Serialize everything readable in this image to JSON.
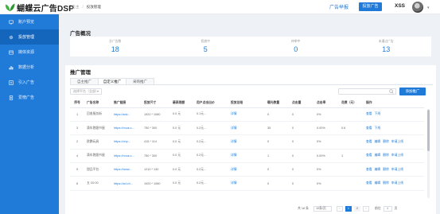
{
  "brand": {
    "name": "蝴蝶云广告DSP",
    "accent": "#1f7ad8",
    "sidebar_active": "#1466bd"
  },
  "breadcrumb": [
    "广告主",
    "投放管理"
  ],
  "header": {
    "link_label": "广告举报",
    "button_label": "投放广告",
    "username": "XSS"
  },
  "sidebar": {
    "items": [
      {
        "label": "账户预览",
        "icon": "monitor-icon",
        "active": false
      },
      {
        "label": "投放管理",
        "icon": "gear-icon",
        "active": true
      },
      {
        "label": "媒体资源",
        "icon": "media-icon",
        "active": false
      },
      {
        "label": "数据分析",
        "icon": "chart-icon",
        "active": false
      },
      {
        "label": "引入广告",
        "icon": "import-icon",
        "active": false
      },
      {
        "label": "爱榜广告",
        "icon": "doc-icon",
        "active": false
      }
    ]
  },
  "overview": {
    "title": "广告概况",
    "stats": [
      {
        "label": "总广告数",
        "value": "18"
      },
      {
        "label": "投放中",
        "value": "5"
      },
      {
        "label": "待审中",
        "value": "0"
      },
      {
        "label": "未通过广告",
        "value": "13"
      }
    ]
  },
  "promo": {
    "title": "推广管理",
    "tabs": [
      {
        "label": "自主推广",
        "active": false
      },
      {
        "label": "自定义推广",
        "active": true
      },
      {
        "label": "采购推广",
        "active": false
      }
    ],
    "filter_label": "选择平台（全部）",
    "search_placeholder": "",
    "add_button": "添加推广",
    "columns": [
      "序号",
      "广告名称",
      "推广链接",
      "投放尺寸",
      "最高限额",
      "用户点击出价",
      "投放总结",
      "曝光数量",
      "点击量",
      "点击率",
      "花费（元）",
      "操作"
    ],
    "rows": [
      {
        "no": "1",
        "name": "回收服务街",
        "url": "https://adv...",
        "size": "1920 * 1080",
        "limit": "0.0 元",
        "bid": "0.1元...",
        "summary": "详情",
        "views": "0",
        "clicks": "0",
        "ctr": "0%",
        "cost": "",
        "ops": [
          "查看",
          "下线"
        ]
      },
      {
        "no": "3",
        "name": "滴车跑跟书屋",
        "url": "https://nous.c...",
        "size": "750 * 300",
        "limit": "0.0 元",
        "bid": "0.2元...",
        "summary": "详情",
        "views": "35",
        "clicks": "0",
        "ctr": "0.00%",
        "cost": "0.6",
        "ops": [
          "查看",
          "下线"
        ]
      },
      {
        "no": "2",
        "name": "欧鹏玩具",
        "url": "https://ohp...",
        "size": "415 * 114",
        "limit": "0.0 元",
        "bid": "0.2元...",
        "summary": "详情",
        "views": "0",
        "clicks": "0",
        "ctr": "0%",
        "cost": "",
        "ops": [
          "查看",
          "编辑",
          "删除",
          "申请上线"
        ]
      },
      {
        "no": "4",
        "name": "滴车跑跟书屋",
        "url": "https://nous.c...",
        "size": "750 * 300",
        "limit": "0.0 元",
        "bid": "0.2元...",
        "summary": "详情",
        "views": "1",
        "clicks": "0",
        "ctr": "0.00%",
        "cost": "1",
        "ops": [
          "查看",
          "编辑",
          "删除",
          "申请上线"
        ]
      },
      {
        "no": "5",
        "name": "甜品平台",
        "url": "https://www...",
        "size": "1210 * 130",
        "limit": "0.0 元",
        "bid": "0.2元...",
        "summary": "详情",
        "views": "0",
        "clicks": "0",
        "ctr": "0%",
        "cost": "",
        "ops": [
          "查看",
          "编辑",
          "删除",
          "申请上线"
        ]
      },
      {
        "no": "6",
        "name": "五·20:00",
        "url": "https://ad.ch...",
        "size": "1920 * 1080",
        "limit": "0.0 元",
        "bid": "0.2元...",
        "summary": "详情",
        "views": "0",
        "clicks": "0",
        "ctr": "0%",
        "cost": "",
        "ops": [
          "查看",
          "编辑",
          "删除",
          "申请上线"
        ]
      }
    ]
  },
  "pagination": {
    "total": "共 18 条",
    "page_size": "10条/页",
    "prev": "‹",
    "pages": [
      "1",
      "2"
    ],
    "current": "1",
    "next": "›",
    "goto_prefix": "前往",
    "goto_value": "1",
    "goto_suffix": "页"
  }
}
